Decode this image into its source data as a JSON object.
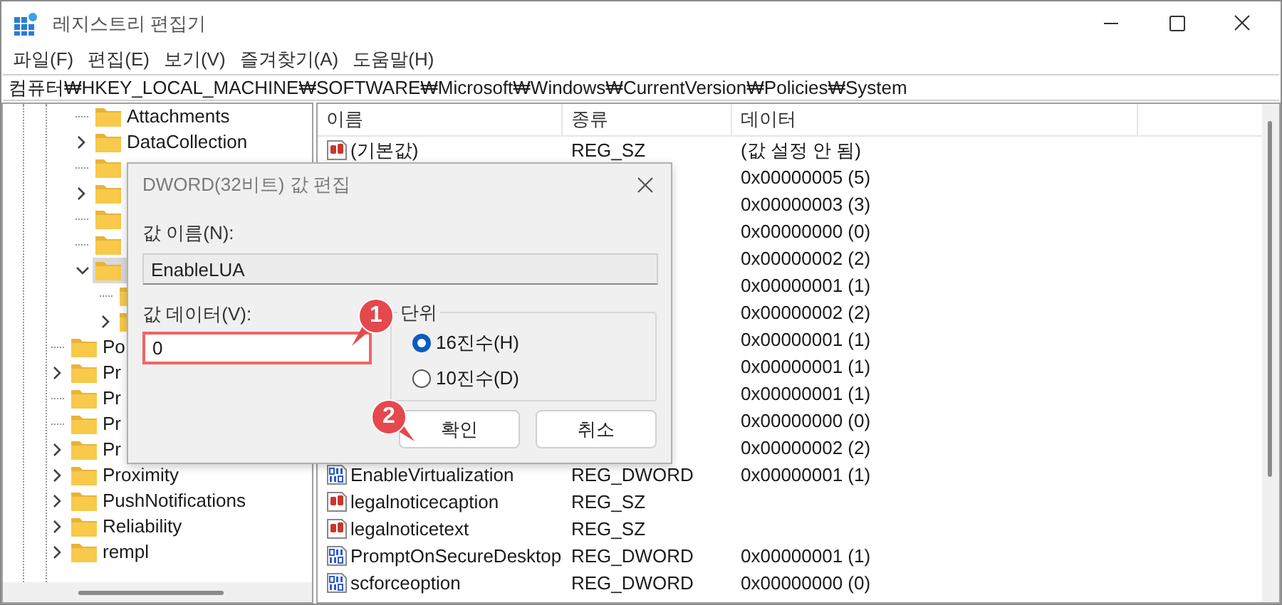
{
  "window": {
    "title": "레지스트리 편집기"
  },
  "menu": [
    "파일(F)",
    "편집(E)",
    "보기(V)",
    "즐겨찾기(A)",
    "도움말(H)"
  ],
  "address": "컴퓨터₩HKEY_LOCAL_MACHINE₩SOFTWARE₩Microsoft₩Windows₩CurrentVersion₩Policies₩System",
  "tree": {
    "items": [
      {
        "children": [
          {
            "label": "Attachments",
            "expandable": false,
            "selected": false
          },
          {
            "label": "DataCollection",
            "expandable": true,
            "expanded": false,
            "selected": false
          },
          {
            "expandable": false,
            "selected": false
          },
          {
            "expandable": true,
            "expanded": false,
            "selected": false
          },
          {
            "expandable": false,
            "selected": false
          },
          {
            "expandable": false,
            "selected": false
          },
          {
            "expandable": true,
            "expanded": true,
            "selected": true,
            "children": [
              {
                "expandable": false
              },
              {
                "expandable": true,
                "expanded": false
              }
            ]
          }
        ]
      },
      {
        "label": "Po",
        "expandable": false,
        "selected": false
      },
      {
        "label": "Pr",
        "expandable": true,
        "expanded": false,
        "selected": false
      },
      {
        "label": "Pr",
        "expandable": false,
        "selected": false
      },
      {
        "label": "Pr",
        "expandable": false,
        "selected": false
      },
      {
        "label": "Pr",
        "expandable": true,
        "expanded": false,
        "selected": false
      },
      {
        "label": "Proximity",
        "expandable": true,
        "expanded": false,
        "selected": false
      },
      {
        "label": "PushNotifications",
        "expandable": true,
        "expanded": false,
        "selected": false
      },
      {
        "label": "Reliability",
        "expandable": true,
        "expanded": false,
        "selected": false
      },
      {
        "label": "rempl",
        "expandable": true,
        "expanded": false,
        "selected": false
      }
    ]
  },
  "values": {
    "columns": [
      "이름",
      "종류",
      "데이터"
    ],
    "rows": [
      {
        "kind": "string",
        "name": "(기본값)",
        "type": "REG_SZ",
        "data": "(값 설정 안 됨)"
      },
      {
        "data": "0x00000005 (5)"
      },
      {
        "data": "0x00000003 (3)"
      },
      {
        "data": "0x00000000 (0)"
      },
      {
        "data": "0x00000002 (2)"
      },
      {
        "data": "0x00000001 (1)"
      },
      {
        "data": "0x00000002 (2)"
      },
      {
        "data": "0x00000001 (1)"
      },
      {
        "data": "0x00000001 (1)"
      },
      {
        "data": "0x00000001 (1)"
      },
      {
        "data": "0x00000000 (0)"
      },
      {
        "data": "0x00000002 (2)"
      },
      {
        "kind": "dword",
        "name": "EnableVirtualization",
        "type": "REG_DWORD",
        "data": "0x00000001 (1)"
      },
      {
        "kind": "string",
        "name": "legalnoticecaption",
        "type": "REG_SZ"
      },
      {
        "kind": "string",
        "name": "legalnoticetext",
        "type": "REG_SZ"
      },
      {
        "kind": "dword",
        "name": "PromptOnSecureDesktop",
        "type": "REG_DWORD",
        "data": "0x00000001 (1)"
      },
      {
        "kind": "dword",
        "name": "scforceoption",
        "type": "REG_DWORD",
        "data": "0x00000000 (0)"
      }
    ]
  },
  "dialog": {
    "title": "DWORD(32비트) 값 편집",
    "name_label": "값 이름(N):",
    "name_value": "EnableLUA",
    "data_label": "값 데이터(V):",
    "data_value": "0",
    "data_highlighted": true,
    "base_group": "단위",
    "base_options": [
      {
        "label": "16진수(H)",
        "selected": true
      },
      {
        "label": "10진수(D)",
        "selected": false
      }
    ],
    "buttons": [
      "확인",
      "취소"
    ]
  },
  "annotations": [
    "1",
    "2"
  ]
}
